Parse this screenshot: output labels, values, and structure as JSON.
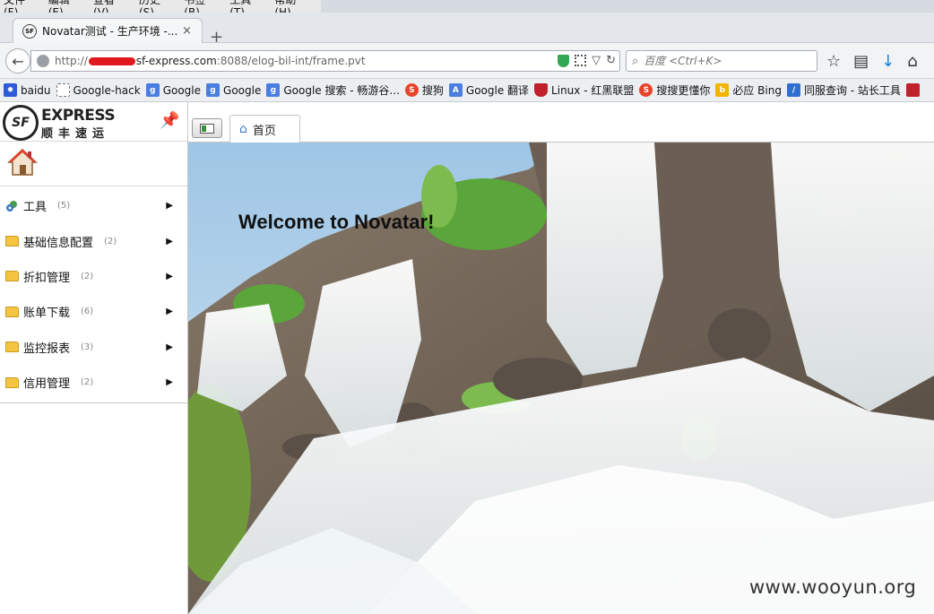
{
  "menubar": {
    "items": [
      "文件(F)",
      "编辑(E)",
      "查看(V)",
      "历史(S)",
      "书签(B)",
      "工具(T)",
      "帮助(H)"
    ]
  },
  "browser_tab": {
    "favicon": "SF",
    "title": "Novatar测试 - 生产环境 -...",
    "close_label": "×",
    "new_tab_label": "+"
  },
  "navbar": {
    "url_scheme": "http://",
    "url_host": "sf-express.com",
    "url_rest": ":8088/elog-bil-int/frame.pvt",
    "search_placeholder": "百度 <Ctrl+K>"
  },
  "bookmarks": [
    {
      "label": "baidu",
      "icon": "paw-icon",
      "color": "#2e5bd8"
    },
    {
      "label": "Google-hack",
      "icon": "blank-page-icon",
      "color": "#ffffff"
    },
    {
      "label": "Google",
      "icon": "google-icon",
      "color": "#4a7ee0"
    },
    {
      "label": "Google",
      "icon": "google-icon",
      "color": "#4a7ee0"
    },
    {
      "label": "Google 搜索 - 畅游谷...",
      "icon": "google-icon",
      "color": "#4a7ee0"
    },
    {
      "label": "搜狗",
      "icon": "sogou-icon",
      "color": "#e8442a"
    },
    {
      "label": "Google 翻译",
      "icon": "translate-icon",
      "color": "#4a7ee0"
    },
    {
      "label": "Linux - 红黑联盟",
      "icon": "shield-icon",
      "color": "#c0212a"
    },
    {
      "label": "搜搜更懂你",
      "icon": "soso-icon",
      "color": "#e8442a"
    },
    {
      "label": "必应 Bing",
      "icon": "bing-icon",
      "color": "#f2b400"
    },
    {
      "label": "同服查询 - 站长工具",
      "icon": "chart-icon",
      "color": "#2e6fd0"
    }
  ],
  "sidebar": {
    "logo_en": "EXPRESS",
    "logo_cn": "顺丰速运",
    "logo_mark": "SF",
    "items": [
      {
        "label": "工具",
        "count": "(5)",
        "icon": "tools-icon"
      },
      {
        "label": "基础信息配置",
        "count": "(2)",
        "icon": "folder-icon"
      },
      {
        "label": "折扣管理",
        "count": "(2)",
        "icon": "folder-icon"
      },
      {
        "label": "账单下载",
        "count": "(6)",
        "icon": "folder-icon"
      },
      {
        "label": "监控报表",
        "count": "(3)",
        "icon": "folder-icon"
      },
      {
        "label": "信用管理",
        "count": "(2)",
        "icon": "folder-icon"
      }
    ]
  },
  "content": {
    "tab_label": "首页",
    "welcome": "Welcome to Novatar!",
    "watermark": "www.wooyun.org"
  }
}
